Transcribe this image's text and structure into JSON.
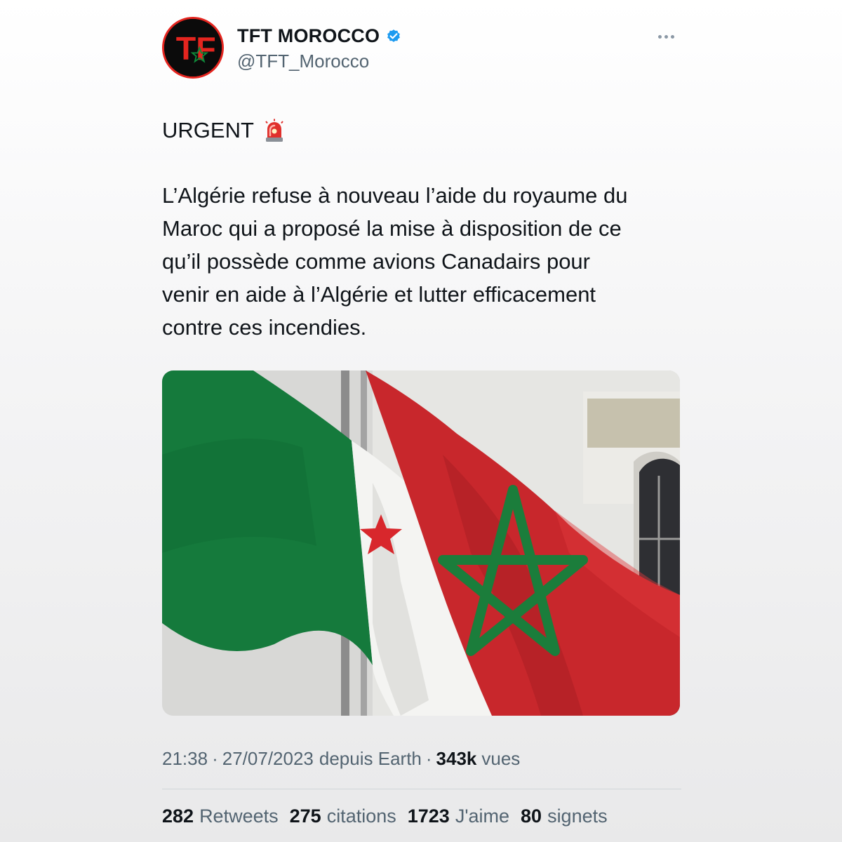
{
  "author": {
    "display_name": "TFT MOROCCO",
    "handle": "@TFT_Morocco",
    "verified": true,
    "avatar_letters": "TF",
    "avatar_icon": "tft-logo-icon"
  },
  "header": {
    "more_icon": "more-horizontal-icon"
  },
  "tweet": {
    "urgent_label": "URGENT",
    "urgent_emoji": "rotating-light-icon",
    "text": "L’Algérie refuse à nouveau l’aide du royaume du\nMaroc qui a proposé la mise à disposition de ce\nqu’il possède comme avions Canadairs pour\nvenir en aide à l’Algérie et lutter efficacement\ncontre ces incendies.",
    "media": {
      "icon": "algeria-morocco-flags-photo"
    }
  },
  "meta": {
    "time": "21:38",
    "date": "27/07/2023",
    "source": "depuis Earth",
    "separator": "·",
    "views_count": "343k",
    "views_label": "vues"
  },
  "stats": {
    "retweets_count": "282",
    "retweets_label": "Retweets",
    "quotes_count": "275",
    "quotes_label": "citations",
    "likes_count": "1723",
    "likes_label": "J'aime",
    "bookmarks_count": "80",
    "bookmarks_label": "signets"
  },
  "colors": {
    "text_primary": "#0f1419",
    "text_secondary": "#536471",
    "verified_blue": "#1d9bf0",
    "morocco_red": "#c1272d",
    "algeria_green": "#0a8a3a"
  }
}
